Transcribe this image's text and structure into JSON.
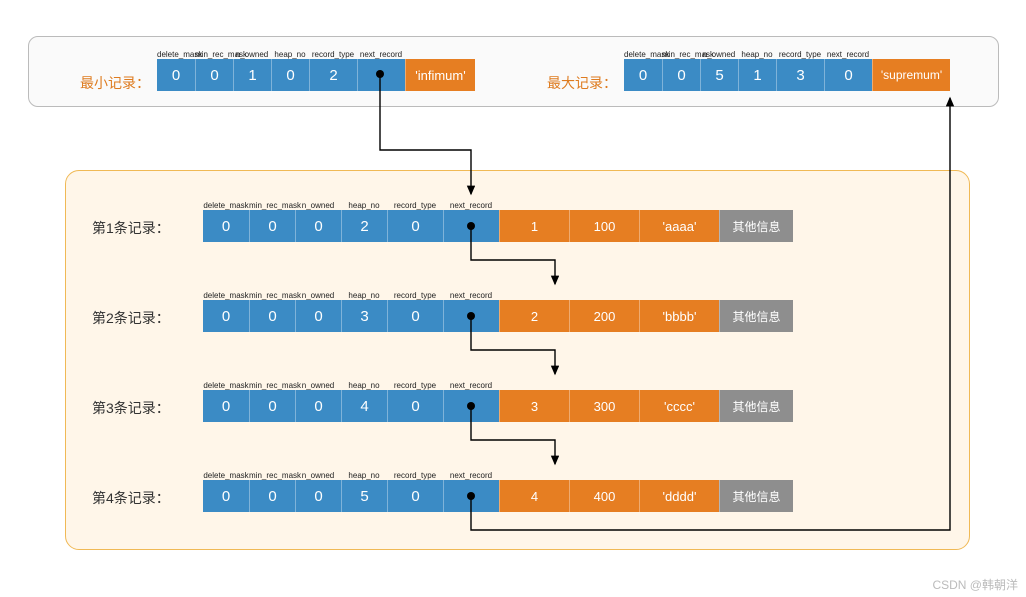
{
  "header_labels": [
    "delete_mask",
    "min_rec_mask",
    "n_owned",
    "heap_no",
    "record_type",
    "next_record"
  ],
  "min_record": {
    "title": "最小记录：",
    "fields": [
      "0",
      "0",
      "1",
      "0",
      "2",
      ""
    ],
    "tag": "'infimum'"
  },
  "max_record": {
    "title": "最大记录：",
    "fields": [
      "0",
      "0",
      "5",
      "1",
      "3",
      "0"
    ],
    "tag": "'supremum'"
  },
  "row_header_labels": [
    "delete_mask",
    "min_rec_mask",
    "n_owned",
    "heap_no",
    "record_type",
    "next_record"
  ],
  "rows": [
    {
      "label": "第1条记录：",
      "fields": [
        "0",
        "0",
        "0",
        "2",
        "0",
        ""
      ],
      "data": [
        "1",
        "100",
        "'aaaa'"
      ],
      "other": "其他信息"
    },
    {
      "label": "第2条记录：",
      "fields": [
        "0",
        "0",
        "0",
        "3",
        "0",
        ""
      ],
      "data": [
        "2",
        "200",
        "'bbbb'"
      ],
      "other": "其他信息"
    },
    {
      "label": "第3条记录：",
      "fields": [
        "0",
        "0",
        "0",
        "4",
        "0",
        ""
      ],
      "data": [
        "3",
        "300",
        "'cccc'"
      ],
      "other": "其他信息"
    },
    {
      "label": "第4条记录：",
      "fields": [
        "0",
        "0",
        "0",
        "5",
        "0",
        ""
      ],
      "data": [
        "4",
        "400",
        "'dddd'"
      ],
      "other": "其他信息"
    }
  ],
  "watermark": "CSDN @韩朝洋"
}
